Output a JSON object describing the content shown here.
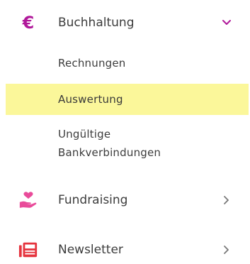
{
  "nav": {
    "accounting": {
      "label": "Buchhaltung",
      "icon": "euro-icon",
      "icon_glyph": "€",
      "icon_color": "#b0189a",
      "chevron_color": "#b0189a",
      "expanded": true,
      "items": [
        {
          "label": "Rechnungen",
          "active": false
        },
        {
          "label": "Auswertung",
          "active": true
        },
        {
          "label_line1": "Ungültige",
          "label_line2": "Bankverbindungen",
          "active": false
        }
      ]
    },
    "fundraising": {
      "label": "Fundraising",
      "icon": "heart-hand-icon",
      "icon_color": "#e94b9a"
    },
    "newsletter": {
      "label": "Newsletter",
      "icon": "newspaper-icon",
      "icon_color": "#e5343e"
    },
    "colors": {
      "active_highlight": "#fbf79a",
      "text": "#3c3c3c",
      "chevron_collapsed": "#777777"
    }
  }
}
